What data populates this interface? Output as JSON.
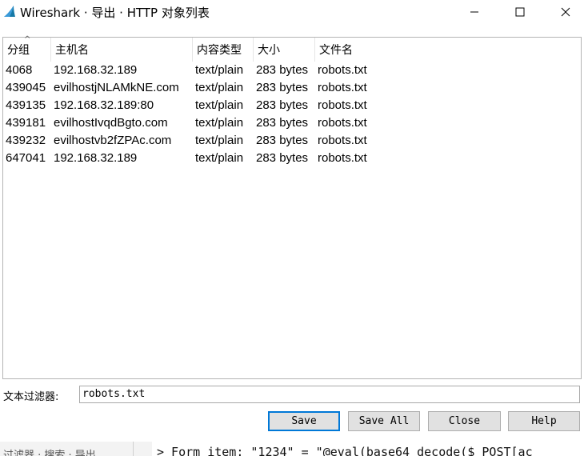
{
  "window": {
    "title": "Wireshark · 导出 · HTTP 对象列表",
    "icon": "wireshark-fin-icon"
  },
  "table": {
    "columns": [
      "分组",
      "主机名",
      "内容类型",
      "大小",
      "文件名"
    ],
    "rows": [
      [
        "4068",
        "192.168.32.189",
        "text/plain",
        "283 bytes",
        "robots.txt"
      ],
      [
        "439045",
        "evilhostjNLAMkNE.com",
        "text/plain",
        "283 bytes",
        "robots.txt"
      ],
      [
        "439135",
        "192.168.32.189:80",
        "text/plain",
        "283 bytes",
        "robots.txt"
      ],
      [
        "439181",
        "evilhostIvqdBgto.com",
        "text/plain",
        "283 bytes",
        "robots.txt"
      ],
      [
        "439232",
        "evilhostvb2fZPAc.com",
        "text/plain",
        "283 bytes",
        "robots.txt"
      ],
      [
        "647041",
        "192.168.32.189",
        "text/plain",
        "283 bytes",
        "robots.txt"
      ]
    ],
    "sorted_column": "分组"
  },
  "filter": {
    "label": "文本过滤器:",
    "value": "robots.txt"
  },
  "buttons": {
    "save": "Save",
    "save_all": "Save All",
    "close": "Close",
    "help": "Help"
  },
  "background": {
    "left_text": "过滤器 · 搜索 · 导出",
    "right_text": "> Form item: \"1234\" = \"@eval(base64_decode($_POST[ac"
  },
  "colors": {
    "accent": "#0078d7",
    "button_bg": "#e1e1e1",
    "wireshark_blue": "#1679a7"
  }
}
